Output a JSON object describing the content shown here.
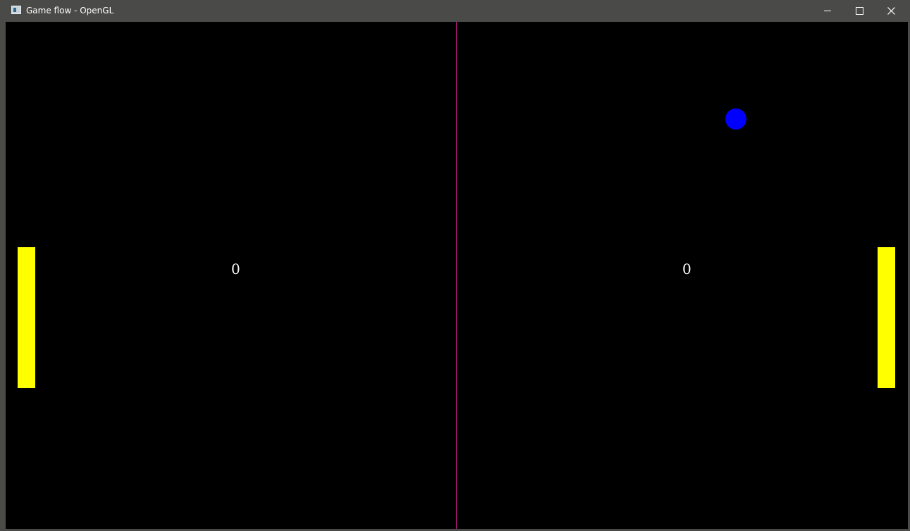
{
  "window": {
    "title": "Game flow - OpenGL",
    "controls": {
      "minimize_icon": "minimize-icon",
      "maximize_icon": "maximize-icon",
      "close_icon": "close-icon"
    }
  },
  "game": {
    "background_color": "#000000",
    "center_line_color": "#b0197a",
    "paddle_color": "#ffff00",
    "ball_color": "#0000ff",
    "scores": {
      "left": "0",
      "right": "0"
    }
  }
}
